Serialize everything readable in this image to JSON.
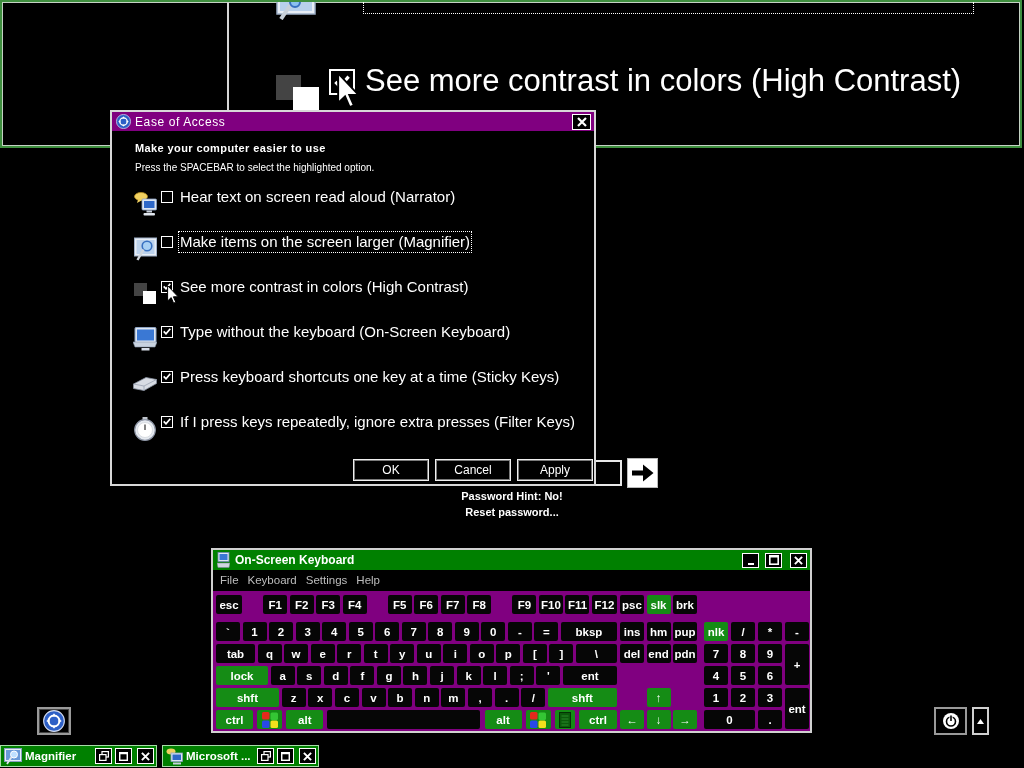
{
  "magnifier": {
    "checked": true,
    "option_label": "See more contrast in colors (High Contrast)"
  },
  "dialog": {
    "title": "Ease of Access",
    "heading": "Make your computer easier to use",
    "instruction": "Press the SPACEBAR to select the highlighted option.",
    "options": [
      {
        "label": "Hear text on screen read aloud (Narrator)",
        "checked": false,
        "focused": false
      },
      {
        "label": "Make items on the screen larger (Magnifier)",
        "checked": false,
        "focused": true
      },
      {
        "label": "See more contrast in colors (High Contrast)",
        "checked": true,
        "focused": false
      },
      {
        "label": "Type without the keyboard (On-Screen Keyboard)",
        "checked": true,
        "focused": false
      },
      {
        "label": "Press keyboard shortcuts one key at a time (Sticky Keys)",
        "checked": true,
        "focused": false
      },
      {
        "label": "If I press keys repeatedly, ignore extra presses (Filter Keys)",
        "checked": true,
        "focused": false
      }
    ],
    "buttons": [
      "OK",
      "Cancel",
      "Apply"
    ]
  },
  "logon": {
    "hint": "Password Hint: No!",
    "reset_link": "Reset password..."
  },
  "keyboard": {
    "title": "On-Screen Keyboard",
    "menu": [
      "File",
      "Keyboard",
      "Settings",
      "Help"
    ],
    "keys": [
      {
        "label": "esc",
        "kind": "key"
      },
      {
        "label": "F1",
        "kind": "key"
      },
      {
        "label": "F2",
        "kind": "key"
      },
      {
        "label": "F3",
        "kind": "key"
      },
      {
        "label": "F4",
        "kind": "key"
      },
      {
        "label": "F5",
        "kind": "key"
      },
      {
        "label": "F6",
        "kind": "key"
      },
      {
        "label": "F7",
        "kind": "key"
      },
      {
        "label": "F8",
        "kind": "key"
      },
      {
        "label": "F9",
        "kind": "key"
      },
      {
        "label": "F10",
        "kind": "key"
      },
      {
        "label": "F11",
        "kind": "key"
      },
      {
        "label": "F12",
        "kind": "key"
      },
      {
        "label": "psc",
        "kind": "key"
      },
      {
        "label": "slk",
        "kind": "special"
      },
      {
        "label": "brk",
        "kind": "key"
      },
      {
        "label": "`",
        "kind": "key"
      },
      {
        "label": "1",
        "kind": "key"
      },
      {
        "label": "2",
        "kind": "key"
      },
      {
        "label": "3",
        "kind": "key"
      },
      {
        "label": "4",
        "kind": "key"
      },
      {
        "label": "5",
        "kind": "key"
      },
      {
        "label": "6",
        "kind": "key"
      },
      {
        "label": "7",
        "kind": "key"
      },
      {
        "label": "8",
        "kind": "key"
      },
      {
        "label": "9",
        "kind": "key"
      },
      {
        "label": "0",
        "kind": "key"
      },
      {
        "label": "-",
        "kind": "key"
      },
      {
        "label": "=",
        "kind": "key"
      },
      {
        "label": "bksp",
        "kind": "key"
      },
      {
        "label": "ins",
        "kind": "key"
      },
      {
        "label": "hm",
        "kind": "key"
      },
      {
        "label": "pup",
        "kind": "key"
      },
      {
        "label": "nlk",
        "kind": "special"
      },
      {
        "label": "/",
        "kind": "key"
      },
      {
        "label": "*",
        "kind": "key"
      },
      {
        "label": "-",
        "kind": "key"
      },
      {
        "label": "tab",
        "kind": "key"
      },
      {
        "label": "q",
        "kind": "key"
      },
      {
        "label": "w",
        "kind": "key"
      },
      {
        "label": "e",
        "kind": "key"
      },
      {
        "label": "r",
        "kind": "key"
      },
      {
        "label": "t",
        "kind": "key"
      },
      {
        "label": "y",
        "kind": "key"
      },
      {
        "label": "u",
        "kind": "key"
      },
      {
        "label": "i",
        "kind": "key"
      },
      {
        "label": "o",
        "kind": "key"
      },
      {
        "label": "p",
        "kind": "key"
      },
      {
        "label": "[",
        "kind": "key"
      },
      {
        "label": "]",
        "kind": "key"
      },
      {
        "label": "\\",
        "kind": "key"
      },
      {
        "label": "del",
        "kind": "key"
      },
      {
        "label": "end",
        "kind": "key"
      },
      {
        "label": "pdn",
        "kind": "key"
      },
      {
        "label": "7",
        "kind": "key"
      },
      {
        "label": "8",
        "kind": "key"
      },
      {
        "label": "9",
        "kind": "key"
      },
      {
        "label": "+",
        "kind": "key"
      },
      {
        "label": "lock",
        "kind": "special"
      },
      {
        "label": "a",
        "kind": "key"
      },
      {
        "label": "s",
        "kind": "key"
      },
      {
        "label": "d",
        "kind": "key"
      },
      {
        "label": "f",
        "kind": "key"
      },
      {
        "label": "g",
        "kind": "key"
      },
      {
        "label": "h",
        "kind": "key"
      },
      {
        "label": "j",
        "kind": "key"
      },
      {
        "label": "k",
        "kind": "key"
      },
      {
        "label": "l",
        "kind": "key"
      },
      {
        "label": ";",
        "kind": "key"
      },
      {
        "label": "'",
        "kind": "key"
      },
      {
        "label": "ent",
        "kind": "key"
      },
      {
        "label": "4",
        "kind": "key"
      },
      {
        "label": "5",
        "kind": "key"
      },
      {
        "label": "6",
        "kind": "key"
      },
      {
        "label": "shft",
        "kind": "special"
      },
      {
        "label": "z",
        "kind": "key"
      },
      {
        "label": "x",
        "kind": "key"
      },
      {
        "label": "c",
        "kind": "key"
      },
      {
        "label": "v",
        "kind": "key"
      },
      {
        "label": "b",
        "kind": "key"
      },
      {
        "label": "n",
        "kind": "key"
      },
      {
        "label": "m",
        "kind": "key"
      },
      {
        "label": ",",
        "kind": "key"
      },
      {
        "label": ".",
        "kind": "key"
      },
      {
        "label": "/",
        "kind": "key"
      },
      {
        "label": "shft",
        "kind": "special"
      },
      {
        "label": "↑",
        "kind": "special"
      },
      {
        "label": "1",
        "kind": "key"
      },
      {
        "label": "2",
        "kind": "key"
      },
      {
        "label": "3",
        "kind": "key"
      },
      {
        "label": "ent",
        "kind": "key"
      },
      {
        "label": "ctrl",
        "kind": "special"
      },
      {
        "kind": "windows"
      },
      {
        "label": "alt",
        "kind": "special"
      },
      {
        "kind": "key"
      },
      {
        "label": "alt",
        "kind": "special"
      },
      {
        "kind": "windows"
      },
      {
        "kind": "menu"
      },
      {
        "label": "ctrl",
        "kind": "special"
      },
      {
        "label": "←",
        "kind": "special"
      },
      {
        "label": "↓",
        "kind": "special"
      },
      {
        "label": "→",
        "kind": "special"
      },
      {
        "label": "0",
        "kind": "key"
      },
      {
        "label": ".",
        "kind": "key"
      }
    ]
  },
  "taskbar": [
    {
      "label": "Magnifier"
    },
    {
      "label": "Microsoft ..."
    }
  ]
}
